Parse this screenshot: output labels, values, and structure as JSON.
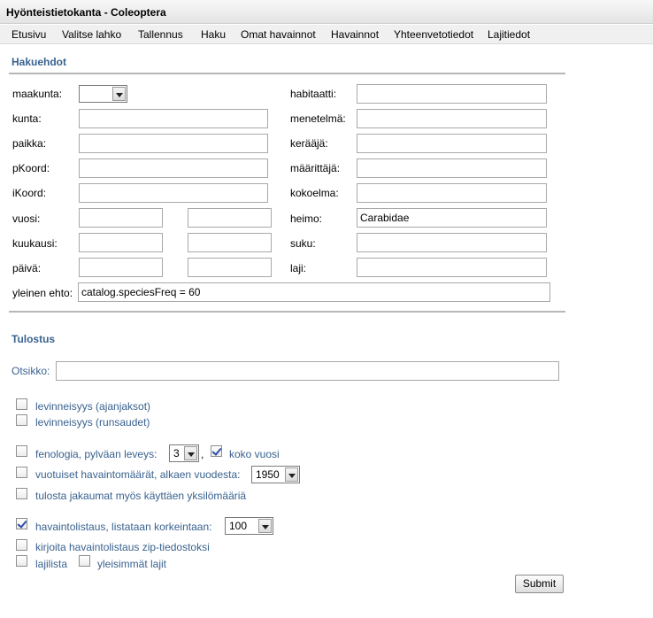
{
  "window": {
    "title": "Hyönteistietokanta - Coleoptera"
  },
  "menu": [
    "Etusivu",
    "Valitse lahko",
    "Tallennus",
    "Haku",
    "Omat havainnot",
    "Havainnot",
    "Yhteenvetotiedot",
    "Lajitiedot"
  ],
  "search": {
    "title": "Hakuehdot",
    "maakunta_label": "maakunta:",
    "maakunta_value": "",
    "kunta_label": "kunta:",
    "paikka_label": "paikka:",
    "pkoord_label": "pKoord:",
    "ikoord_label": "iKoord:",
    "vuosi_label": "vuosi:",
    "kuukausi_label": "kuukausi:",
    "paiva_label": "päivä:",
    "habitaatti_label": "habitaatti:",
    "menetelma_label": "menetelmä:",
    "keraaja_label": "kerääjä:",
    "maarittaja_label": "määrittäjä:",
    "kokoelma_label": "kokoelma:",
    "heimo_label": "heimo:",
    "heimo_value": "Carabidae",
    "suku_label": "suku:",
    "laji_label": "laji:",
    "yleinen_label": "yleinen ehto:",
    "yleinen_value": "catalog.speciesFreq = 60"
  },
  "output": {
    "title": "Tulostus",
    "otsikko_label": "Otsikko:",
    "levinneisyys_ajanjaksot": "levinneisyys (ajanjaksot)",
    "levinneisyys_runsaudet": "levinneisyys (runsaudet)",
    "fenologia_label": "fenologia,  pylväan leveys:",
    "fenologia_value": "3",
    "comma": ",",
    "koko_vuosi": "koko vuosi",
    "vuotuiset_label": "vuotuiset havaintomäärät, alkaen vuodesta:",
    "vuotuiset_value": "1950",
    "jakaumat_label": "tulosta jakaumat myös käyttäen yksilömääriä",
    "havaintolistaus_label": "havaintolistaus, listataan korkeintaan:",
    "havaintolistaus_value": "100",
    "zip_label": "kirjoita havaintolistaus zip-tiedostoksi",
    "lajilista_label": "lajilista",
    "yleisimmat_label": "yleisimmät lajit",
    "submit": "Submit"
  }
}
